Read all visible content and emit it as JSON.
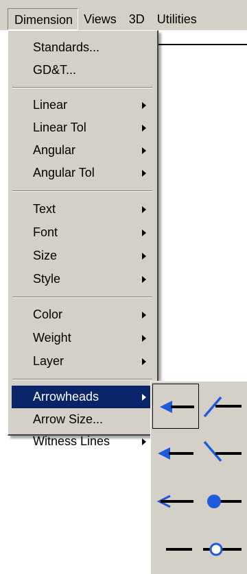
{
  "menubar": {
    "items": [
      {
        "label": "Dimension",
        "open": true
      },
      {
        "label": "Views"
      },
      {
        "label": "3D"
      },
      {
        "label": "Utilities"
      }
    ]
  },
  "dimension_menu": {
    "groups": [
      [
        "Standards...",
        "GD&T..."
      ],
      [
        "Linear",
        "Linear Tol",
        "Angular",
        "Angular Tol"
      ],
      [
        "Text",
        "Font",
        "Size",
        "Style"
      ],
      [
        "Color",
        "Weight",
        "Layer"
      ],
      [
        "Arrowheads",
        "Arrow Size...",
        "Witness Lines"
      ]
    ],
    "highlighted": "Arrowheads"
  },
  "arrowheads_submenu": {
    "options": [
      {
        "icon": "filled-arrow-left-icon",
        "selected": true
      },
      {
        "icon": "slash-tick-up-icon"
      },
      {
        "icon": "filled-arrow-left-icon-2"
      },
      {
        "icon": "slash-tick-down-icon"
      },
      {
        "icon": "open-arrow-left-icon"
      },
      {
        "icon": "filled-dot-icon"
      },
      {
        "icon": "no-arrow-line-icon"
      },
      {
        "icon": "open-circle-icon"
      }
    ],
    "colors": {
      "arrow": "#1e5adc",
      "line": "#000000"
    }
  }
}
